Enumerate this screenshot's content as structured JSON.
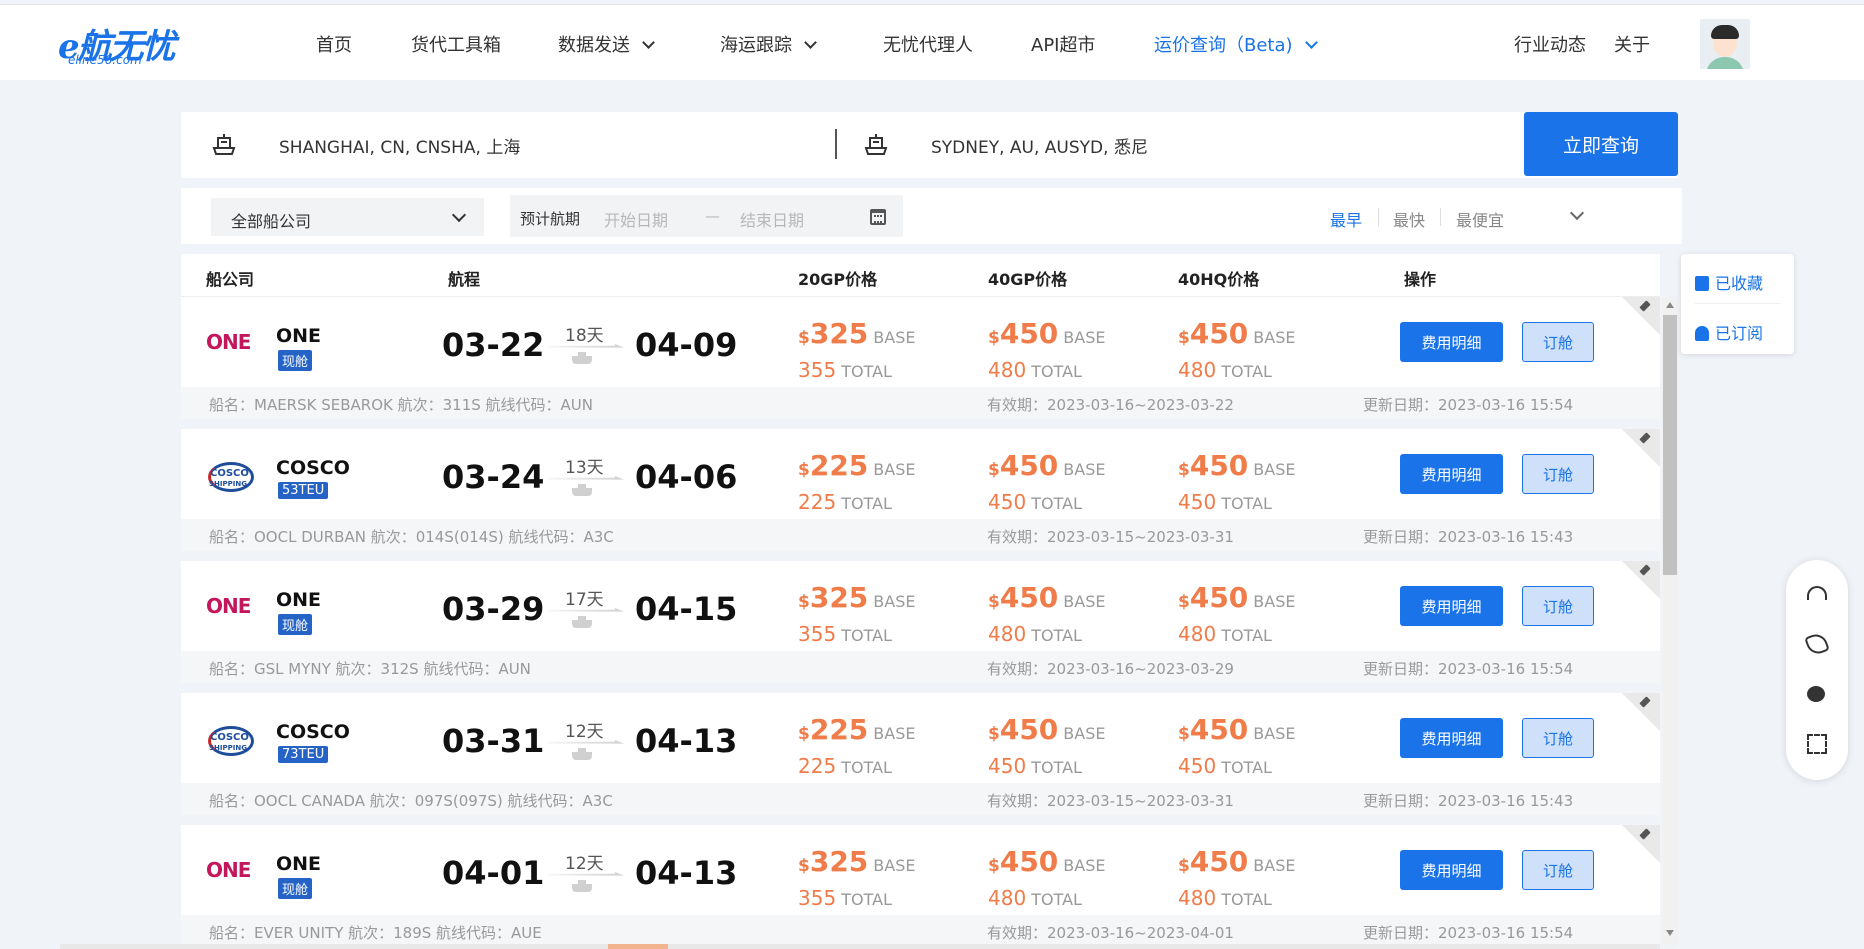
{
  "header": {
    "logo_main": "e航无忧",
    "logo_sub": "eline56.com",
    "nav": [
      {
        "label": "首页"
      },
      {
        "label": "货代工具箱"
      },
      {
        "label": "数据发送"
      },
      {
        "label": "海运跟踪"
      },
      {
        "label": "无忧代理人"
      },
      {
        "label": "API超市"
      },
      {
        "label": "运价查询（Beta)"
      },
      {
        "label": "行业动态"
      },
      {
        "label": "关于"
      }
    ]
  },
  "search": {
    "origin": "SHANGHAI, CN, CNSHA, 上海",
    "destination": "SYDNEY, AU, AUSYD, 悉尼",
    "button": "立即查询"
  },
  "filter": {
    "carrier_select": "全部船公司",
    "date_label": "预计航期",
    "start_placeholder": "开始日期",
    "dash": "—",
    "end_placeholder": "结束日期",
    "sort": [
      "最早",
      "最快",
      "最便宜"
    ]
  },
  "columns": {
    "carrier": "船公司",
    "route": "航程",
    "gp20": "20GP价格",
    "gp40": "40GP价格",
    "hq40": "40HQ价格",
    "action": "操作"
  },
  "labels": {
    "currency": "$",
    "base": "BASE",
    "total": "TOTAL",
    "fee_button": "费用明细",
    "book_button": "订舱"
  },
  "favorites": {
    "saved": "已收藏",
    "subscribed": "已订阅"
  },
  "rows": [
    {
      "carrier": "ONE",
      "badge": "现舱",
      "dep": "03-22",
      "days": "18天",
      "arr": "04-09",
      "gp20_base": "325",
      "gp20_total": "355",
      "gp40_base": "450",
      "gp40_total": "480",
      "hq40_base": "450",
      "hq40_total": "480",
      "vessel": "船名：MAERSK SEBAROK 航次：311S 航线代码：AUN",
      "validity": "有效期：2023-03-16~2023-03-22",
      "updated": "更新日期：2023-03-16 15:54"
    },
    {
      "carrier": "COSCO",
      "badge": "53TEU",
      "dep": "03-24",
      "days": "13天",
      "arr": "04-06",
      "gp20_base": "225",
      "gp20_total": "225",
      "gp40_base": "450",
      "gp40_total": "450",
      "hq40_base": "450",
      "hq40_total": "450",
      "vessel": "船名：OOCL DURBAN 航次：014S(014S) 航线代码：A3C",
      "validity": "有效期：2023-03-15~2023-03-31",
      "updated": "更新日期：2023-03-16 15:43"
    },
    {
      "carrier": "ONE",
      "badge": "现舱",
      "dep": "03-29",
      "days": "17天",
      "arr": "04-15",
      "gp20_base": "325",
      "gp20_total": "355",
      "gp40_base": "450",
      "gp40_total": "480",
      "hq40_base": "450",
      "hq40_total": "480",
      "vessel": "船名：GSL MYNY 航次：312S 航线代码：AUN",
      "validity": "有效期：2023-03-16~2023-03-29",
      "updated": "更新日期：2023-03-16 15:54"
    },
    {
      "carrier": "COSCO",
      "badge": "73TEU",
      "dep": "03-31",
      "days": "12天",
      "arr": "04-13",
      "gp20_base": "225",
      "gp20_total": "225",
      "gp40_base": "450",
      "gp40_total": "450",
      "hq40_base": "450",
      "hq40_total": "450",
      "vessel": "船名：OOCL CANADA 航次：097S(097S) 航线代码：A3C",
      "validity": "有效期：2023-03-15~2023-03-31",
      "updated": "更新日期：2023-03-16 15:43"
    },
    {
      "carrier": "ONE",
      "badge": "现舱",
      "dep": "04-01",
      "days": "12天",
      "arr": "04-13",
      "gp20_base": "325",
      "gp20_total": "355",
      "gp40_base": "450",
      "gp40_total": "480",
      "hq40_base": "450",
      "hq40_total": "480",
      "vessel": "船名：EVER UNITY 航次：189S 航线代码：AUE",
      "validity": "有效期：2023-03-16~2023-04-01",
      "updated": "更新日期：2023-03-16 15:54"
    }
  ]
}
